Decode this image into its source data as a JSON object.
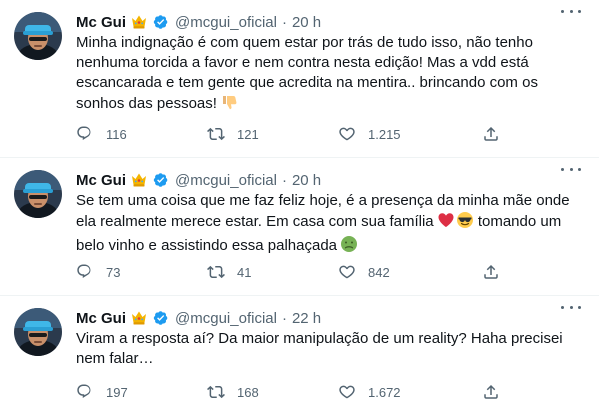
{
  "tweets": [
    {
      "name": "Mc Gui",
      "handle": "@mcgui_oficial",
      "separator": "·",
      "time": "20 h",
      "text": "Minha indignação é com quem estar por trás de tudo isso, não tenho nenhuma torcida a favor e nem contra nesta edição! Mas a vdd está escancarada e tem gente que acredita na mentira.. brincando com os sonhos das pessoas!",
      "emojis": [
        "thumbs-down"
      ],
      "replies": "116",
      "retweets": "121",
      "likes": "1.215"
    },
    {
      "name": "Mc Gui",
      "handle": "@mcgui_oficial",
      "separator": "·",
      "time": "20 h",
      "text_a": "Se tem uma coisa que me faz feliz hoje, é a presença da minha mãe onde ela realmente merece estar. Em casa com sua família",
      "text_b": "tomando um belo vinho e assistindo essa palhaçada",
      "emojis": [
        "red-heart",
        "sunglasses-face",
        "nauseated-face"
      ],
      "replies": "73",
      "retweets": "41",
      "likes": "842"
    },
    {
      "name": "Mc Gui",
      "handle": "@mcgui_oficial",
      "separator": "·",
      "time": "22 h",
      "text": "Viram a resposta aí? Da maior manipulação de um reality? Haha precisei nem falar…",
      "replies": "197",
      "retweets": "168",
      "likes": "1.672"
    }
  ],
  "colors": {
    "text": "#0f1419",
    "secondary": "#536471",
    "verified": "#1d9bf0",
    "divider": "#eff3f4",
    "crown": "#f4b400"
  }
}
